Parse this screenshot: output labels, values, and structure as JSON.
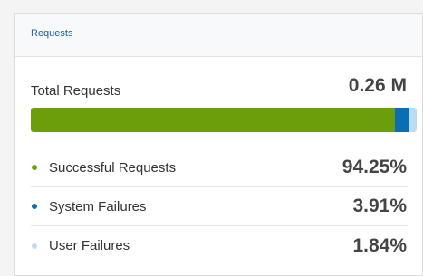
{
  "panel": {
    "title": "Requests"
  },
  "total": {
    "label": "Total Requests",
    "value": "0.26 M"
  },
  "colors": {
    "success": "#6b9e0a",
    "system_failure": "#0a6eb5",
    "user_failure": "#b9def3",
    "title": "#1a5fa6"
  },
  "breakdown": [
    {
      "label": "Successful Requests",
      "value": "94.25%",
      "share": 94.25,
      "color": "#6b9e0a"
    },
    {
      "label": "System Failures",
      "value": "3.91%",
      "share": 3.91,
      "color": "#0a6eb5"
    },
    {
      "label": "User Failures",
      "value": "1.84%",
      "share": 1.84,
      "color": "#b9def3"
    }
  ]
}
